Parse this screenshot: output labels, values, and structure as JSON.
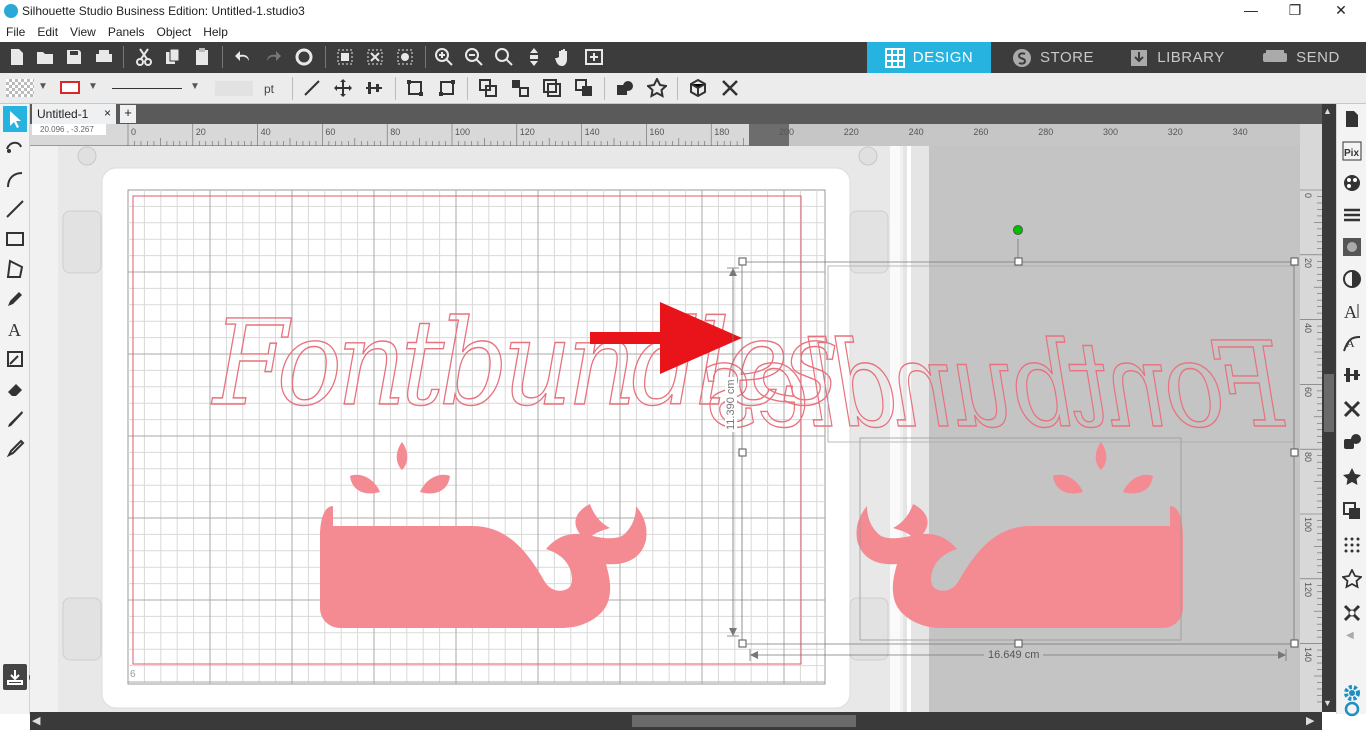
{
  "window": {
    "title": "Silhouette Studio Business Edition: Untitled-1.studio3"
  },
  "menu": [
    "File",
    "Edit",
    "View",
    "Panels",
    "Object",
    "Help"
  ],
  "top_tabs": [
    {
      "label": "DESIGN",
      "icon": "grid-icon",
      "active": true
    },
    {
      "label": "STORE",
      "icon": "silhouette-s-icon",
      "active": false
    },
    {
      "label": "LIBRARY",
      "icon": "library-download-icon",
      "active": false
    },
    {
      "label": "SEND",
      "icon": "cutter-icon",
      "active": false
    }
  ],
  "line_style": {
    "unit": "pt",
    "width_value": ""
  },
  "document": {
    "tab_label": "Untitled-1",
    "close_symbol": "×",
    "add_symbol": "+",
    "cursor_readout": "20.096 , -3.267"
  },
  "ruler": {
    "h_labels": [
      "0",
      "20",
      "40",
      "60",
      "80",
      "100",
      "120",
      "140",
      "160",
      "180",
      "200",
      "220",
      "240",
      "260",
      "280",
      "300",
      "320",
      "340"
    ],
    "v_labels": [
      "0",
      "20",
      "40",
      "60",
      "80",
      "100",
      "120",
      "140"
    ]
  },
  "canvas": {
    "corner_label": "6",
    "height_dimension": "11.390 cm",
    "width_dimension": "16.649 cm",
    "design_text": "Fontbundles",
    "colors": {
      "shape": "#f48b93",
      "outline": "#e06070",
      "arrow": "#e8141a",
      "accent": "#27b3e0",
      "selection_handle": "#00c000"
    }
  }
}
